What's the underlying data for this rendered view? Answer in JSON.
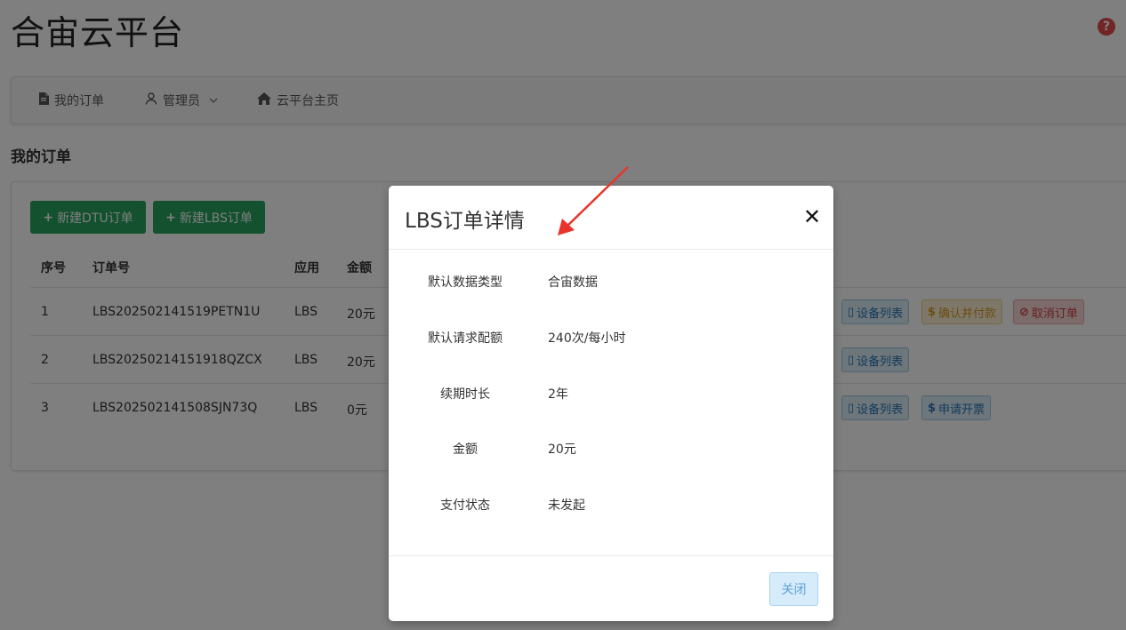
{
  "app": {
    "title": "合宙云平台"
  },
  "nav": {
    "orders": "我的订单",
    "admin": "管理员",
    "home": "云平台主页"
  },
  "section": {
    "title": "我的订单"
  },
  "toolbar": {
    "new_dtu": "新建DTU订单",
    "new_lbs": "新建LBS订单"
  },
  "table": {
    "headers": {
      "idx": "序号",
      "no": "订单号",
      "app": "应用",
      "amount": "金额"
    },
    "rows": [
      {
        "idx": "1",
        "no": "LBS202502141519PETN1U",
        "app": "LBS",
        "amount": "20元",
        "actions": [
          "设备列表",
          "确认并付款",
          "取消订单"
        ]
      },
      {
        "idx": "2",
        "no": "LBS20250214151918QZCX",
        "app": "LBS",
        "amount": "20元",
        "actions": [
          "设备列表"
        ]
      },
      {
        "idx": "3",
        "no": "LBS202502141508SJN73Q",
        "app": "LBS",
        "amount": "0元",
        "actions": [
          "设备列表",
          "申请开票"
        ]
      }
    ]
  },
  "modal": {
    "title": "LBS订单详情",
    "fields": [
      {
        "label": "默认数据类型",
        "value": "合宙数据"
      },
      {
        "label": "默认请求配额",
        "value": "240次/每小时"
      },
      {
        "label": "续期时长",
        "value": "2年"
      },
      {
        "label": "金额",
        "value": "20元"
      },
      {
        "label": "支付状态",
        "value": "未发起"
      }
    ],
    "close_label": "关闭"
  },
  "colors": {
    "green": "#27a25e",
    "overlay": "rgba(0,0,0,0.5)",
    "arrow": "#e8342b"
  }
}
